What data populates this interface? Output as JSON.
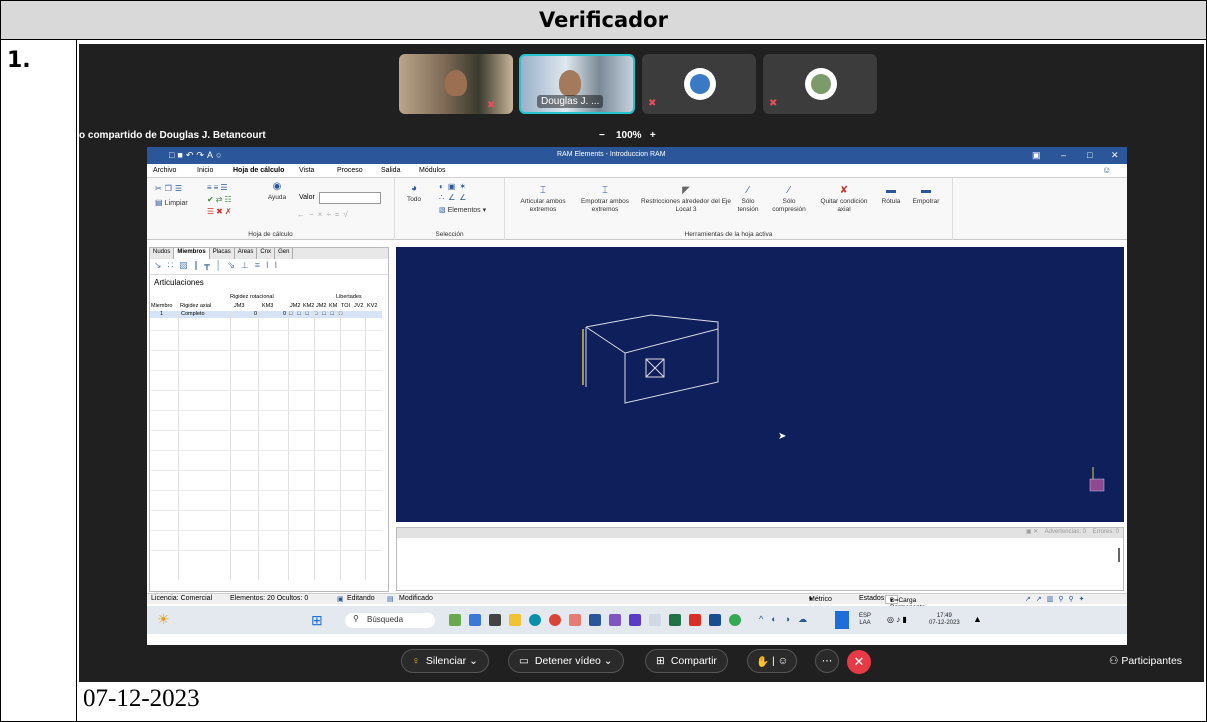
{
  "doc": {
    "header": "Verificador",
    "row_number": "1.",
    "date": "07-12-2023"
  },
  "meeting": {
    "tile_name": "Douglas J. ...",
    "share_title": "o compartido de Douglas J. Betancourt",
    "zoom_minus": "−",
    "zoom": "100%",
    "zoom_plus": "+",
    "controls": {
      "mute": "Silenciar",
      "stop_video": "Detener vídeo",
      "share": "Compartir",
      "participants": "Participantes"
    }
  },
  "ram": {
    "title": "RAM Elements - Introduccion RAM",
    "menu": [
      "Archivo",
      "Inicio",
      "Hoja de cálculo",
      "Vista",
      "Proceso",
      "Salida",
      "Módulos"
    ],
    "ribbon": {
      "limpiar": "Limpiar",
      "ayuda": "Ayuda",
      "valor": "Valor",
      "todo": "Todo",
      "elementos": "Elementos",
      "group_hoja": "Hoja de cálculo",
      "group_seleccion": "Selección",
      "group_herramientas": "Herramientas de la hoja activa",
      "tools": [
        "Articular ambos extremos",
        "Empotrar ambos extremos",
        "Restricciones alrededor del Eje Local 3",
        "Sólo tensión",
        "Sólo compresión",
        "Quitar condición axial",
        "Rótula",
        "Empotrar"
      ]
    },
    "panel": {
      "tabs": [
        "Nudos",
        "Miembros",
        "Placas",
        "Areas",
        "Cnx",
        "Gen"
      ],
      "title": "Articulaciones",
      "group_headers": {
        "rigidez_rotacional": "Rigidez rotacional",
        "libertades": "Libertades"
      },
      "columns": [
        "Miembro",
        "Rigidez axial",
        "JM3",
        "KM3",
        "JM2",
        "KM2",
        "JM2",
        "KM",
        "TOI",
        "JV2",
        "KV2"
      ],
      "row": {
        "miembro": "1",
        "rigidez_axial": "Completo",
        "jm3": "0",
        "km3": "0"
      }
    },
    "output_tabs": {
      "advertencias": "Advertencias: 0",
      "errores": "Errores: 0"
    },
    "status": {
      "licencia": "Licencia: Comercial",
      "elementos": "Elementos: 20 Ocultos: 0",
      "editando": "Editando",
      "modificado": "Modificado",
      "metrico": "Métrico",
      "estados": "Estados:",
      "carga": "D=Carga Permanente"
    },
    "taskbar": {
      "search": "Búsqueda",
      "lang1": "ESP",
      "lang2": "LAA",
      "time": "17:49",
      "date": "07-12-2023"
    }
  },
  "colors": {
    "accent": "#2b579a",
    "viewport": "#0e1f5b",
    "leave": "#e63b46"
  }
}
